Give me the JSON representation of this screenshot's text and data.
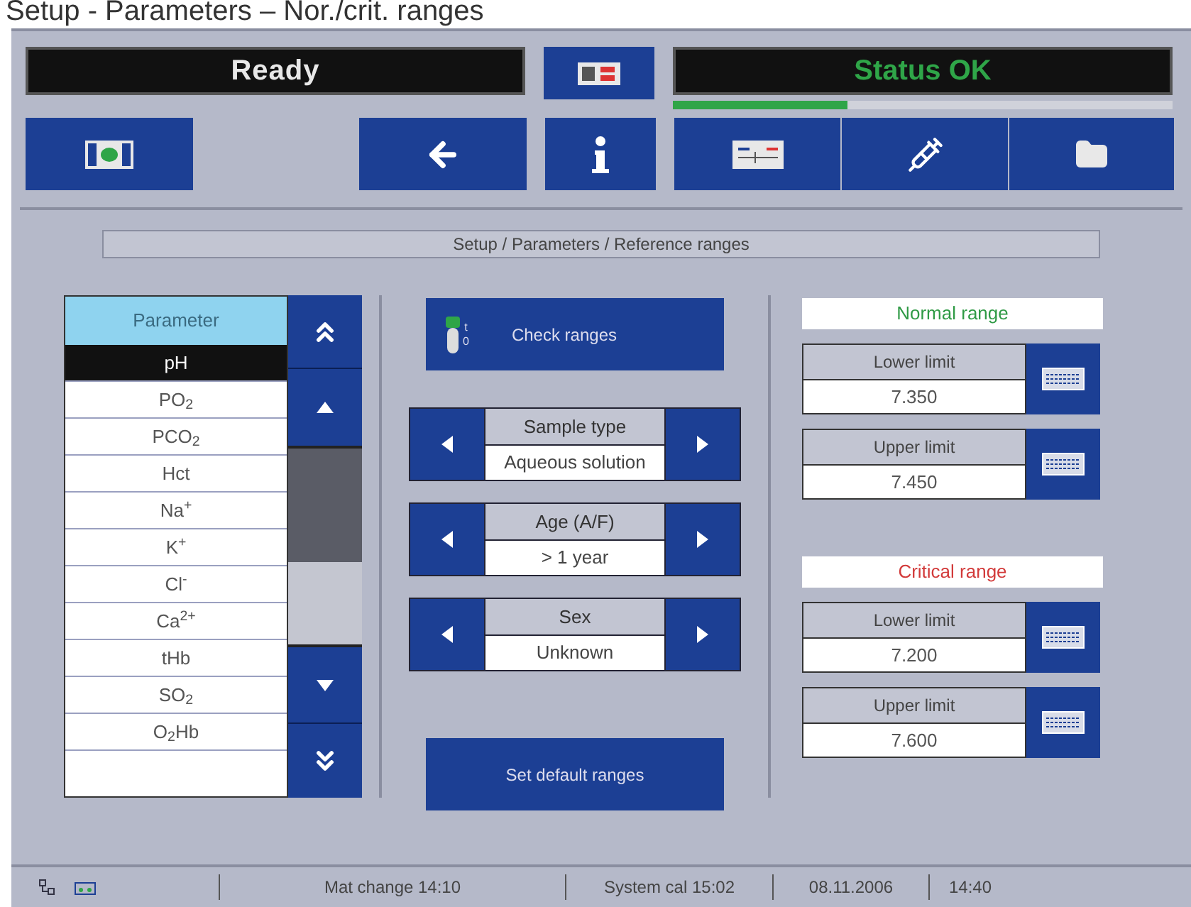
{
  "caption": "Setup - Parameters – Nor./crit. ranges",
  "status": {
    "left": "Ready",
    "right": "Status OK",
    "level": 0.35
  },
  "breadcrumb": "Setup / Parameters / Reference ranges",
  "parameter_list": {
    "header": "Parameter",
    "items": [
      {
        "label": "pH",
        "selected": true
      },
      {
        "label": "PO$_{2}$",
        "selected": false
      },
      {
        "label": "PCO$_{2}$",
        "selected": false
      },
      {
        "label": "Hct",
        "selected": false
      },
      {
        "label": "Na$^{+}$",
        "selected": false
      },
      {
        "label": "K$^{+}$",
        "selected": false
      },
      {
        "label": "Cl$^{-}$",
        "selected": false
      },
      {
        "label": "Ca$^{2+}$",
        "selected": false
      },
      {
        "label": "tHb",
        "selected": false
      },
      {
        "label": "SO$_{2}$",
        "selected": false
      },
      {
        "label": "O$_{2}$Hb",
        "selected": false
      }
    ]
  },
  "check_button": "Check ranges",
  "tube_marks": [
    "t",
    "0"
  ],
  "selectors": [
    {
      "label": "Sample type",
      "value": "Aqueous solution"
    },
    {
      "label": "Age (A/F)",
      "value": "> 1 year"
    },
    {
      "label": "Sex",
      "value": "Unknown"
    }
  ],
  "default_button": "Set default ranges",
  "ranges": [
    {
      "kind": "normal",
      "title": "Normal range",
      "limits": [
        {
          "label": "Lower limit",
          "value": "7.350"
        },
        {
          "label": "Upper limit",
          "value": "7.450"
        }
      ]
    },
    {
      "kind": "critical",
      "title": "Critical range",
      "limits": [
        {
          "label": "Lower limit",
          "value": "7.200"
        },
        {
          "label": "Upper limit",
          "value": "7.600"
        }
      ]
    }
  ],
  "status_bar": {
    "fields": [
      "Mat change 14:10",
      "System cal 15:02",
      "08.11.2006",
      "14:40"
    ]
  }
}
